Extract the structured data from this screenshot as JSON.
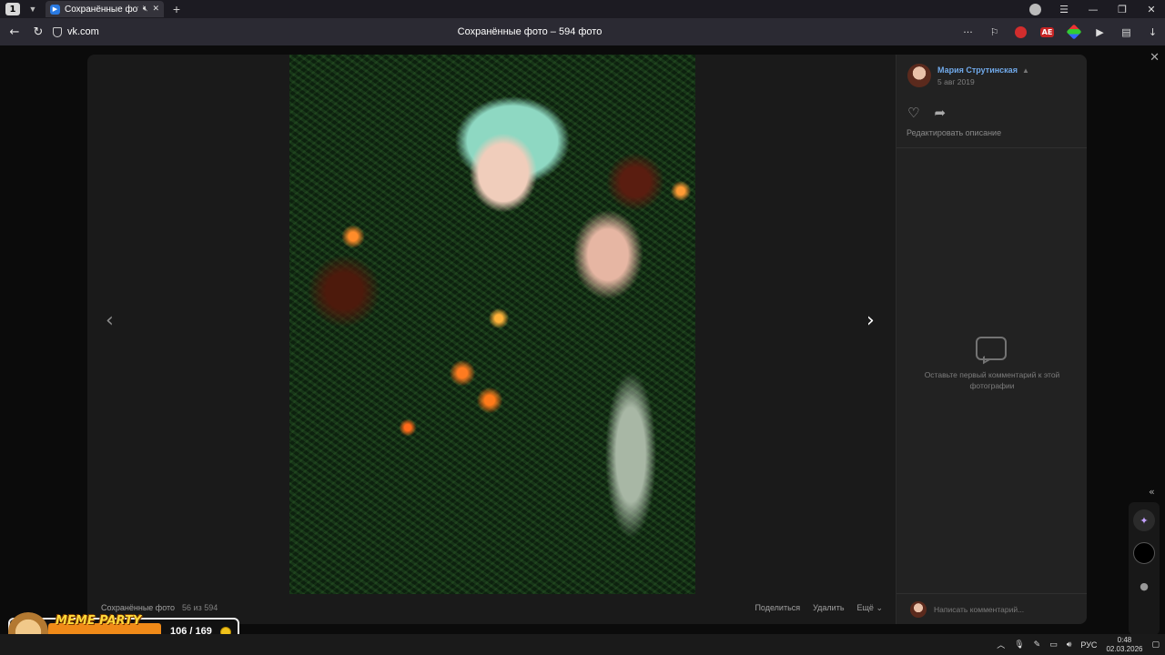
{
  "browser": {
    "tab_counter": "1",
    "tab": {
      "title": "Сохранённые фото"
    },
    "url": "vk.com",
    "page_title": "Сохранённые фото – 594 фото"
  },
  "viewer": {
    "author": {
      "name": "Мария Струтинская",
      "date": "5 авг 2019"
    },
    "edit_description": "Редактировать описание",
    "empty_comments": "Оставьте первый комментарий к этой фотографии",
    "comment_placeholder": "Написать комментарий...",
    "album_name": "Сохранённые фото",
    "position": "56 из 594",
    "actions": {
      "share": "Поделиться",
      "delete": "Удалить",
      "more": "Ещё"
    }
  },
  "overlay": {
    "brand": "MEME PARTY",
    "score": "106 / 169"
  },
  "taskbar": {
    "lang": "РУС",
    "time": "0:48",
    "date": "02.03.2026"
  },
  "colors": {
    "link": "#71aaeb",
    "brand_orange": "#f08a18",
    "vk_blue": "#2a7ae2"
  }
}
